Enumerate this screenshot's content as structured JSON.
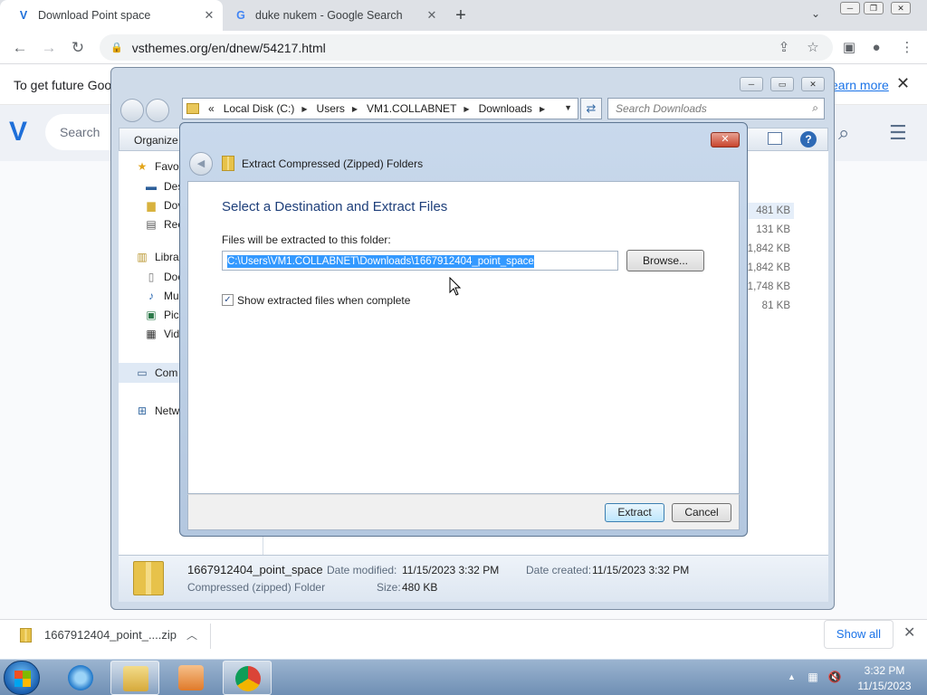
{
  "browser": {
    "tabs": [
      {
        "title": "Download Point space",
        "favicon": "vsthemes-logo-icon",
        "active": true
      },
      {
        "title": "duke nukem - Google Search",
        "favicon": "google-icon",
        "active": false
      }
    ],
    "address": "vsthemes.org/en/dnew/54217.html"
  },
  "page": {
    "infobar_text": "To get future Goog",
    "infobar_link": "earn more",
    "search_placeholder": "Search"
  },
  "explorer": {
    "breadcrumb": [
      "«",
      "Local Disk (C:)",
      "Users",
      "VM1.COLLABNET",
      "Downloads"
    ],
    "search_placeholder": "Search Downloads",
    "command": {
      "organize": "Organize"
    },
    "nav": {
      "favorites": "Favor",
      "desktop": "Des",
      "downloads": "Dov",
      "recent": "Rec",
      "libraries": "Libra",
      "documents": "Doc",
      "music": "Mu",
      "pictures": "Pic",
      "videos": "Vid",
      "computer": "Com",
      "network": "Netw"
    },
    "sizes": [
      "481 KB",
      "131 KB",
      "1,842 KB",
      "1,842 KB",
      "1,748 KB",
      "81 KB"
    ],
    "details": {
      "name": "1667912404_point_space",
      "type": "Compressed (zipped) Folder",
      "modified_label": "Date modified:",
      "modified_value": "11/15/2023 3:32 PM",
      "created_label": "Date created:",
      "created_value": "11/15/2023 3:32 PM",
      "size_label": "Size:",
      "size_value": "480 KB"
    }
  },
  "dialog": {
    "title": "Extract Compressed (Zipped) Folders",
    "heading": "Select a Destination and Extract Files",
    "folder_label": "Files will be extracted to this folder:",
    "path": "C:\\Users\\VM1.COLLABNET\\Downloads\\1667912404_point_space",
    "browse_label": "Browse...",
    "show_files_label": "Show extracted files when complete",
    "show_files_checked": true,
    "extract_label": "Extract",
    "cancel_label": "Cancel"
  },
  "downloads_bar": {
    "filename": "1667912404_point_....zip",
    "show_all": "Show all"
  },
  "taskbar": {
    "time": "3:32 PM",
    "date": "11/15/2023"
  }
}
